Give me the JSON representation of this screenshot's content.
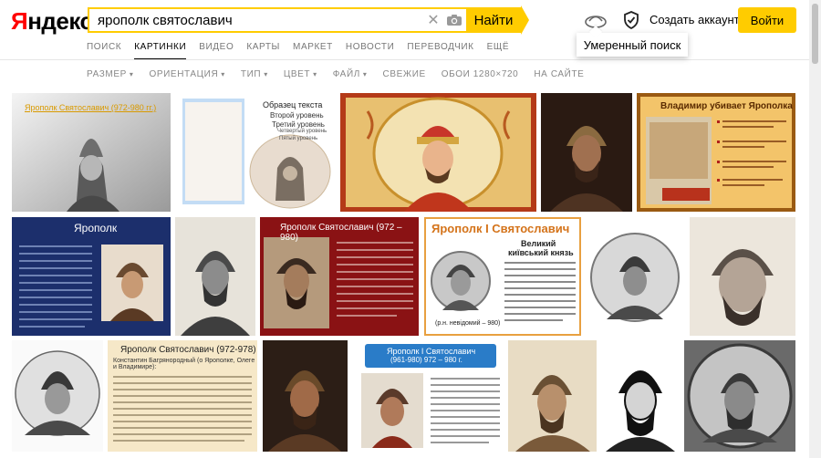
{
  "header": {
    "logo": "Яндекс",
    "logo_first_letter": "Я",
    "logo_rest": "ндекс",
    "search_value": "ярополк святославич",
    "find_label": "Найти",
    "create_account": "Создать аккаунт",
    "login_label": "Войти"
  },
  "tooltip": "Умеренный поиск",
  "nav": [
    "ПОИСК",
    "КАРТИНКИ",
    "ВИДЕО",
    "КАРТЫ",
    "МАРКЕТ",
    "НОВОСТИ",
    "ПЕРЕВОДЧИК",
    "ЕЩЁ"
  ],
  "filters": [
    "РАЗМЕР",
    "ОРИЕНТАЦИЯ",
    "ТИП",
    "ЦВЕТ",
    "ФАЙЛ",
    "СВЕЖИЕ",
    "ОБОИ 1280×720",
    "НА САЙТЕ"
  ],
  "colors": {
    "accent": "#ffcc00",
    "logo_red": "#ff0000"
  },
  "thumbs": {
    "t1": {
      "title": "Ярополк Святославич (972-980 гг.)"
    },
    "t2": {
      "title": "Образец текста",
      "l2": "Второй уровень",
      "l3": "Третий уровень",
      "l4": "Четвертый уровень",
      "l5": "Пятый уровень"
    },
    "t5": {
      "title": "Владимир убивает Ярополка"
    },
    "t7": {
      "title": "Ярополк"
    },
    "t9": {
      "title": "Ярополк Святославич (972 – 980)"
    },
    "t10": {
      "title": "Ярополк І Святославич",
      "sub1": "Великий",
      "sub2": "київський князь",
      "caption": "(р.н. невідомий – 980)"
    },
    "t14": {
      "title": "Ярополк Святославич (972-978)",
      "body": "Константин Багрянородный (о Ярополке, Олеге и Владимире):"
    },
    "t16": {
      "title": "Ярополк I Святославич",
      "sub": "(961-980) 972 – 980 г."
    }
  }
}
